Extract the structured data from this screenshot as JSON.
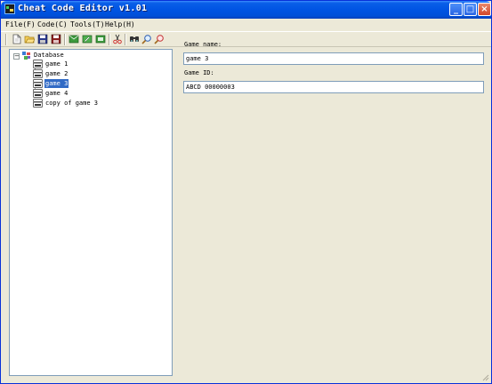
{
  "window": {
    "title": "Cheat Code Editor v1.01",
    "controls": {
      "minimize": "_",
      "maximize": "□",
      "close": "×"
    }
  },
  "menu": {
    "items": [
      "File(F)",
      "Code(C)",
      "Tools(T)",
      "Help(H)"
    ]
  },
  "toolbar": {
    "tools": [
      "new-file-icon",
      "open-folder-icon",
      "save-icon",
      "save-as-icon",
      "add-game-icon",
      "edit-game-icon",
      "import-icon",
      "cut-icon",
      "find-icon",
      "zoom-icon",
      "zoom-next-icon"
    ]
  },
  "tree": {
    "expander": "−",
    "root": "Database",
    "items": [
      "game 1",
      "game 2",
      "game 3",
      "game 4",
      "copy of game 3"
    ],
    "selected_index": 2
  },
  "form": {
    "game_name_label": "Game name:",
    "game_name_value": "game 3",
    "game_id_label": "Game ID:",
    "game_id_value": "ABCD 00000003"
  },
  "colors": {
    "title_bar": "#0054e3",
    "face": "#ece9d8",
    "selection": "#316ac5",
    "input_border": "#7f9db9"
  }
}
